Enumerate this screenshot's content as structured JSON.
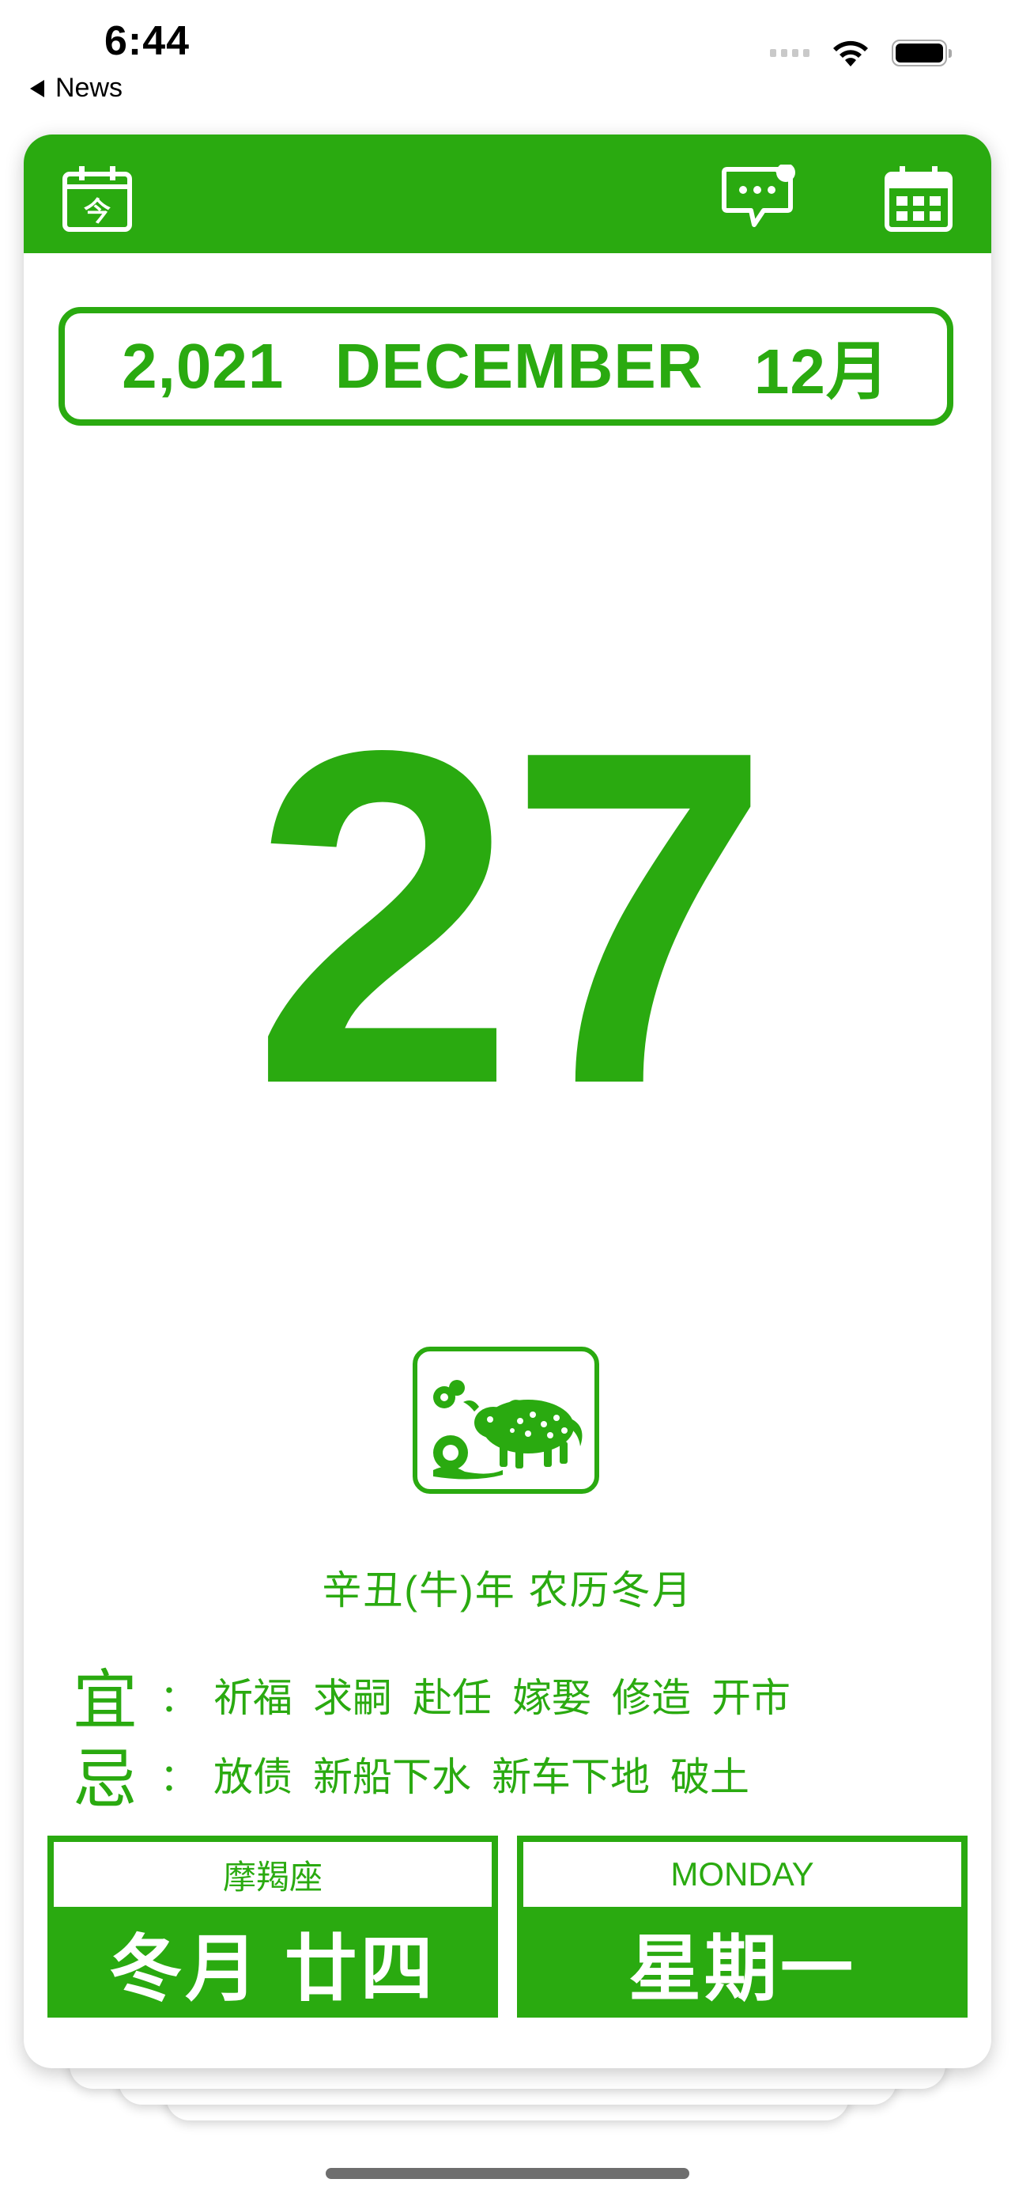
{
  "status_bar": {
    "time": "6:44",
    "back_label": "News",
    "wifi_icon": "wifi-icon",
    "battery_icon": "battery-icon"
  },
  "toolbar": {
    "today_icon_text": "今",
    "icons": [
      "today-icon",
      "message-icon",
      "calendar-icon"
    ]
  },
  "header": {
    "year": "2,021",
    "month_en": "DECEMBER",
    "month_zh": "12月"
  },
  "day": "27",
  "zodiac": {
    "image": "ox-papercut-image",
    "lunar_year": "辛丑(牛)年 农历冬月"
  },
  "yi": {
    "label": "宜",
    "colon": "：",
    "items": [
      "祈福",
      "求嗣",
      "赴任",
      "嫁娶",
      "修造",
      "开市"
    ]
  },
  "ji": {
    "label": "忌",
    "colon": "：",
    "items": [
      "放债",
      "新船下水",
      "新车下地",
      "破土"
    ]
  },
  "left_box": {
    "constellation": "摩羯座",
    "lunar_date": "冬月 廿四"
  },
  "right_box": {
    "weekday_en": "MONDAY",
    "weekday_zh": "星期一"
  },
  "colors": {
    "accent": "#2aaa10",
    "background": "#ffffff"
  }
}
